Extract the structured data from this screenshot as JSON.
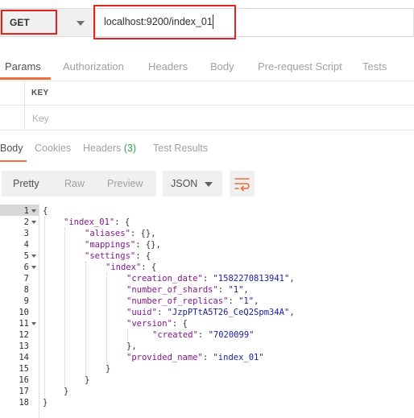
{
  "request": {
    "method": "GET",
    "url": "localhost:9200/index_01"
  },
  "request_tabs": [
    "Params",
    "Authorization",
    "Headers",
    "Body",
    "Pre-request Script",
    "Tests"
  ],
  "params": {
    "key_header": "KEY",
    "key_placeholder": "Key"
  },
  "response_tabs": {
    "body": "Body",
    "cookies": "Cookies",
    "headers": "Headers",
    "headers_count": "(3)",
    "test_results": "Test Results"
  },
  "view_modes": [
    "Pretty",
    "Raw",
    "Preview"
  ],
  "format": "JSON",
  "line_numbers": [
    "1",
    "2",
    "3",
    "4",
    "5",
    "6",
    "7",
    "8",
    "9",
    "10",
    "11",
    "12",
    "13",
    "14",
    "15",
    "16",
    "17",
    "18"
  ],
  "code": {
    "l1": "{",
    "l2_key": "\"index_01\"",
    "l2_rest": ": {",
    "l3_key": "\"aliases\"",
    "l3_rest": ": {},",
    "l4_key": "\"mappings\"",
    "l4_rest": ": {},",
    "l5_key": "\"settings\"",
    "l5_rest": ": {",
    "l6_key": "\"index\"",
    "l6_rest": ": {",
    "l7_key": "\"creation_date\"",
    "l7_sep": ": ",
    "l7_val": "\"1582270813941\"",
    "l7_end": ",",
    "l8_key": "\"number_of_shards\"",
    "l8_sep": ": ",
    "l8_val": "\"1\"",
    "l8_end": ",",
    "l9_key": "\"number_of_replicas\"",
    "l9_sep": ": ",
    "l9_val": "\"1\"",
    "l9_end": ",",
    "l10_key": "\"uuid\"",
    "l10_sep": ": ",
    "l10_val": "\"JzpPTtA5T26_CeQ2Spm34A\"",
    "l10_end": ",",
    "l11_key": "\"version\"",
    "l11_rest": ": {",
    "l12_key": "\"created\"",
    "l12_sep": ": ",
    "l12_val": "\"7020099\"",
    "l13": "},",
    "l14_key": "\"provided_name\"",
    "l14_sep": ": ",
    "l14_val": "\"index_01\"",
    "l15": "}",
    "l16": "}",
    "l17": "}",
    "l18": "}"
  },
  "colors": {
    "accent": "#f26b3a",
    "highlight_box": "#e0231e",
    "json_key": "#881391",
    "json_string": "#1a1aa6",
    "count_green": "#2fa84f"
  },
  "icons": {
    "method_dropdown": "chevron-down-icon",
    "format_dropdown": "chevron-down-icon",
    "wrap_lines": "wrap-lines-icon",
    "fold": "fold-arrow-icon"
  }
}
